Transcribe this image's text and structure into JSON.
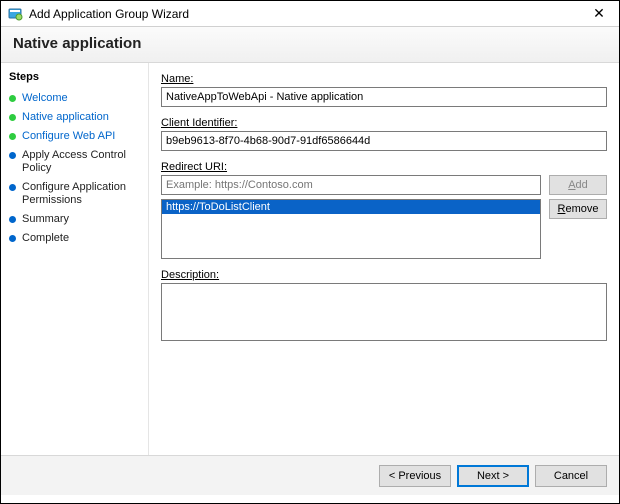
{
  "window": {
    "title": "Add Application Group Wizard",
    "icon": "wizard-icon",
    "close_glyph": "✕"
  },
  "header": {
    "title": "Native application"
  },
  "sidebar": {
    "heading": "Steps",
    "items": [
      {
        "label": "Welcome",
        "state": "done"
      },
      {
        "label": "Native application",
        "state": "current"
      },
      {
        "label": "Configure Web API",
        "state": "done"
      },
      {
        "label": "Apply Access Control Policy",
        "state": "todo"
      },
      {
        "label": "Configure Application Permissions",
        "state": "todo"
      },
      {
        "label": "Summary",
        "state": "todo"
      },
      {
        "label": "Complete",
        "state": "todo"
      }
    ]
  },
  "form": {
    "name_label_pre": "N",
    "name_label_post": "ame:",
    "name_value": "NativeAppToWebApi - Native application",
    "client_id_label_pre": "C",
    "client_id_label_post": "lient Identifier:",
    "client_id_value": "b9eb9613-8f70-4b68-90d7-91df6586644d",
    "redirect_label_pre": "R",
    "redirect_label_post": "edirect URI:",
    "redirect_placeholder": "Example: https://Contoso.com",
    "redirect_value": "",
    "redirect_items": [
      "https://ToDoListClient"
    ],
    "add_pre": "A",
    "add_post": "dd",
    "remove_pre": "R",
    "remove_post": "emove",
    "desc_label_pre": "D",
    "desc_label_post": "escription:",
    "desc_value": ""
  },
  "footer": {
    "previous": "< Previous",
    "next": "Next >",
    "cancel": "Cancel"
  }
}
